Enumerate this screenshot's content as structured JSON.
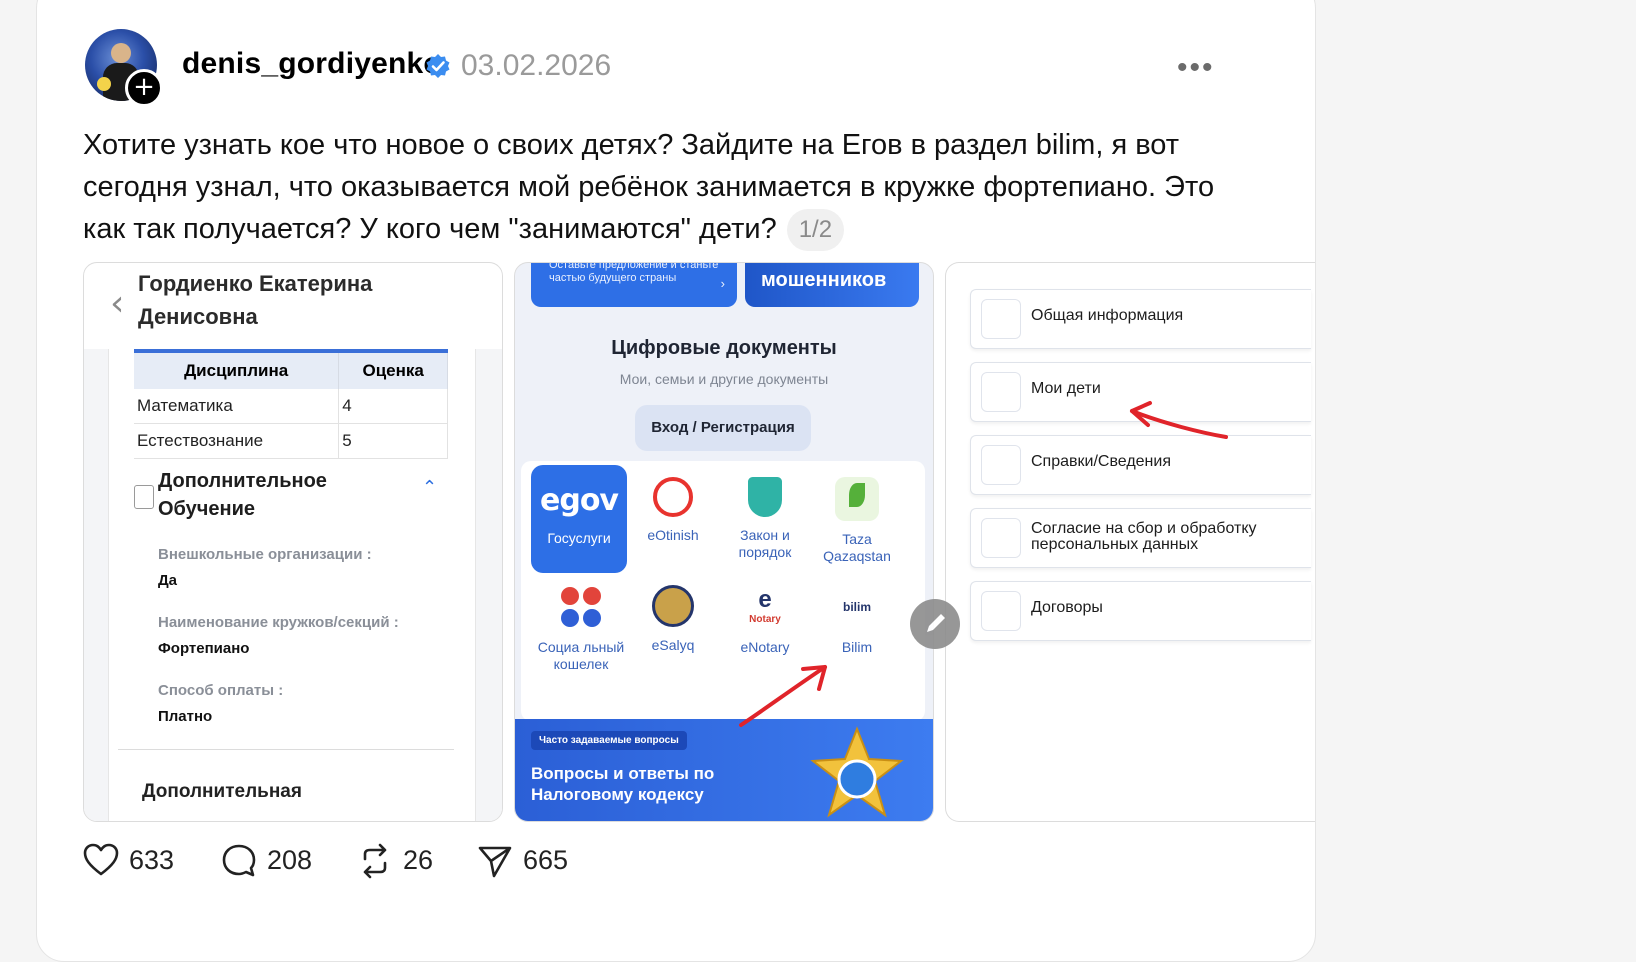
{
  "post": {
    "username": "denis_gordiyenko",
    "date": "03.02.2026",
    "more_label": "•••",
    "text": "Хотите узнать кое что новое о своих детях? Зайдите на Егов в раздел bilim, я вот сегодня узнал, что оказывается мой ребёнок занимается в кружке фортепиано. Это как так получается? У кого чем \"занимаются\" дети?",
    "counter": "1/2"
  },
  "image1": {
    "back_icon": "‹",
    "title": "Гордиенко Екатерина Денисовна",
    "table": {
      "headers": [
        "Дисциплина",
        "Оценка"
      ],
      "rows": [
        [
          "Математика",
          "4"
        ],
        [
          "Естествознание",
          "5"
        ]
      ]
    },
    "section_title": "Дополнительное Обучение",
    "chevron": "⌃",
    "fields": [
      {
        "label": "Внешкольные организации :",
        "value": "Да"
      },
      {
        "label": "Наименование кружков/секций :",
        "value": "Фортепиано"
      },
      {
        "label": "Способ оплаты :",
        "value": "Платно"
      }
    ],
    "cutoff_text": "Дополнительная"
  },
  "image2": {
    "banner_a": "Оставьте предложение и станьте частью будущего страны",
    "banner_a_arrow": "›",
    "banner_b": "мошенников",
    "docs_title": "Цифровые документы",
    "docs_subtitle": "Мои, семьи и другие документы",
    "login_button": "Вход / Регистрация",
    "egov_logo": "egov",
    "egov_label": "Госуслуги",
    "apps": [
      "eOtinish",
      "Закон и порядок",
      "Taza Qazaqstan",
      "Социа льный кошелек",
      "eSalyq",
      "eNotary",
      "Bilim"
    ],
    "faq_pill": "Часто задаваемые вопросы",
    "faq_text": "Вопросы и ответы по Налоговому кодексу"
  },
  "image3": {
    "menu": [
      "Общая информация",
      "Мои дети",
      "Справки/Сведения",
      "Согласие на сбор и обработку персональных данных",
      "Договоры"
    ]
  },
  "actions": {
    "likes": "633",
    "comments": "208",
    "reposts": "26",
    "shares": "665"
  },
  "colors": {
    "accent_blue": "#2d6fe6",
    "verified_blue": "#3b8df0",
    "annotation_red": "#e0242a"
  }
}
